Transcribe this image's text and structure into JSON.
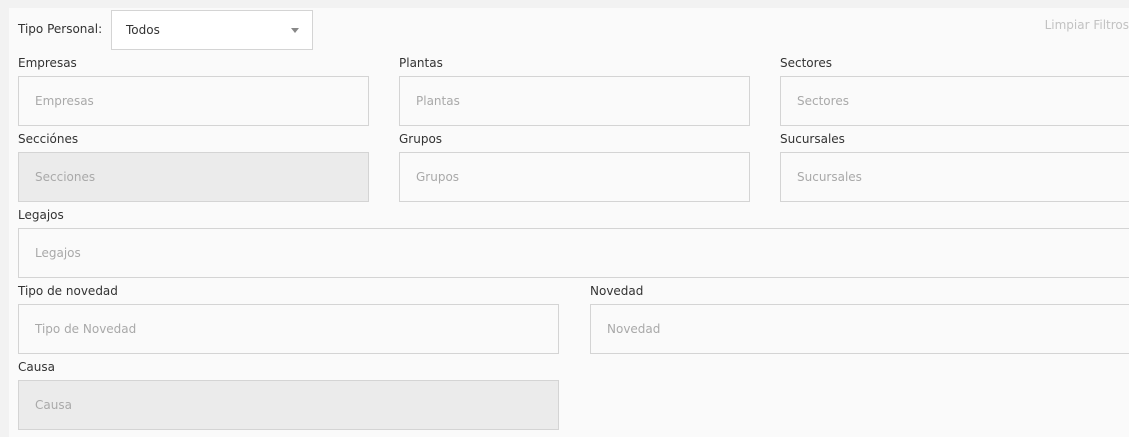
{
  "header": {
    "tipo_personal_label": "Tipo Personal:",
    "tipo_personal_value": "Todos",
    "clear_filters": "Limpiar Filtros"
  },
  "fields": {
    "empresas": {
      "label": "Empresas",
      "placeholder": "Empresas"
    },
    "plantas": {
      "label": "Plantas",
      "placeholder": "Plantas"
    },
    "sectores": {
      "label": "Sectores",
      "placeholder": "Sectores"
    },
    "secciones": {
      "label": "Secciónes",
      "placeholder": "Secciones"
    },
    "grupos": {
      "label": "Grupos",
      "placeholder": "Grupos"
    },
    "sucursales": {
      "label": "Sucursales",
      "placeholder": "Sucursales"
    },
    "legajos": {
      "label": "Legajos",
      "placeholder": "Legajos"
    },
    "tipo_novedad": {
      "label": "Tipo de novedad",
      "placeholder": "Tipo de Novedad"
    },
    "novedad": {
      "label": "Novedad",
      "placeholder": "Novedad"
    },
    "causa": {
      "label": "Causa",
      "placeholder": "Causa"
    }
  }
}
